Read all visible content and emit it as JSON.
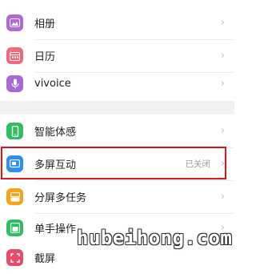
{
  "settings": {
    "items": [
      {
        "label": "相册",
        "icon": "photo-icon",
        "color": "#b06ad8"
      },
      {
        "label": "日历",
        "icon": "calendar-icon",
        "color": "#ef6a7a"
      },
      {
        "label": "vivoice",
        "icon": "microphone-icon",
        "color": "#a56ad6"
      },
      {
        "label": "智能体感",
        "icon": "phone-motion-icon",
        "color": "#2fbf60"
      },
      {
        "label": "多屏互动",
        "icon": "screen-cast-icon",
        "color": "#2d8ff0",
        "status": "已关闭"
      },
      {
        "label": "分屏多任务",
        "icon": "split-screen-icon",
        "color": "#f5a31d"
      },
      {
        "label": "单手操作",
        "icon": "one-hand-icon",
        "color": "#2fbf60"
      },
      {
        "label": "截屏",
        "icon": "screenshot-icon",
        "color": "#e84c6a"
      }
    ]
  },
  "watermark": "hubeihong.com",
  "highlight_color": "#d8171e"
}
